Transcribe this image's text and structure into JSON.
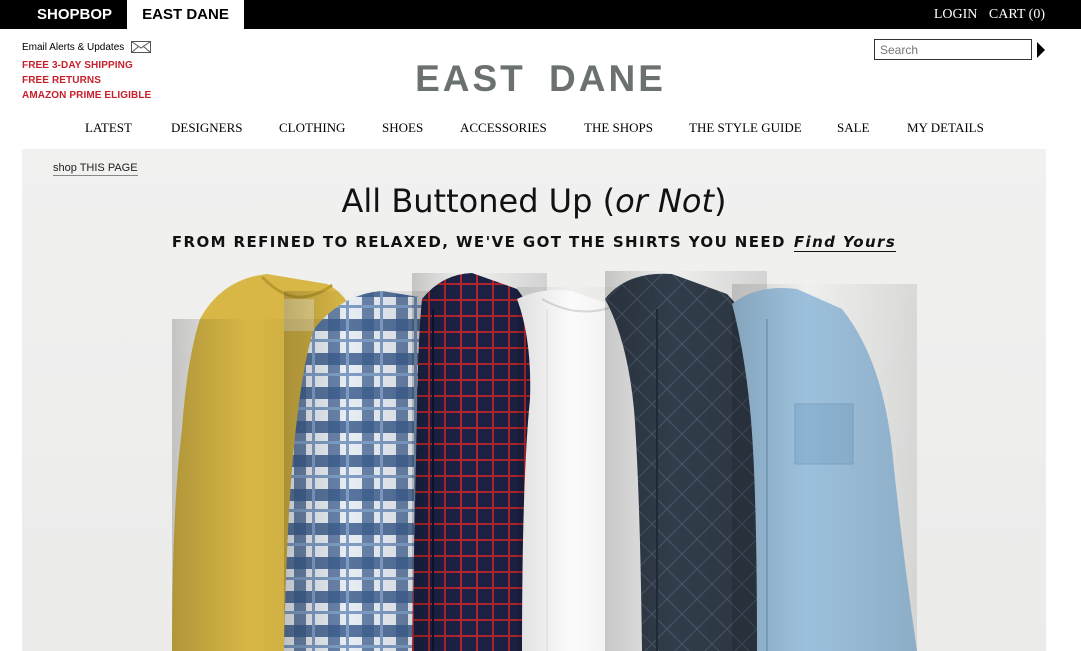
{
  "topbar": {
    "tabs": [
      "SHOPBOP",
      "EAST DANE"
    ],
    "login": "LOGIN",
    "cart": "CART (0)"
  },
  "header": {
    "email_alerts": "Email Alerts & Updates",
    "promos": [
      "FREE 3-DAY SHIPPING",
      "FREE RETURNS",
      "AMAZON PRIME ELIGIBLE"
    ],
    "logo": "EAST DANE",
    "search_placeholder": "Search"
  },
  "nav": [
    "LATEST",
    "DESIGNERS",
    "CLOTHING",
    "SHOES",
    "ACCESSORIES",
    "THE SHOPS",
    "THE STYLE GUIDE",
    "SALE",
    "MY DETAILS"
  ],
  "hero": {
    "shop_page": "shop THIS PAGE",
    "title_main": "All Buttoned Up (",
    "title_italic": "or Not",
    "title_end": ")",
    "subtitle": "FROM REFINED TO RELAXED, WE'VE GOT THE SHIRTS YOU NEED",
    "cta": "Find Yours"
  },
  "colors": {
    "promo": "#c8202c",
    "logo": "#6a716e",
    "topbar": "#000000"
  }
}
